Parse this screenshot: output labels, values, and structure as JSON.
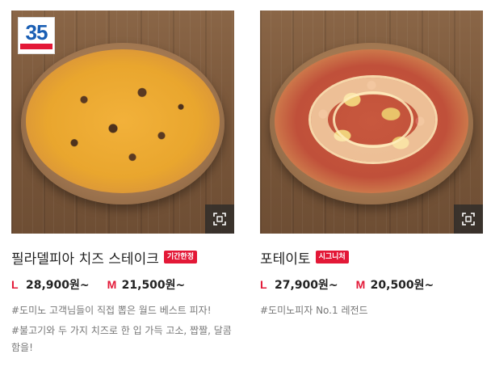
{
  "products": [
    {
      "name": "필라델피아 치즈 스테이크",
      "tag": "기간한정",
      "anniversary_badge": "35",
      "sizes": [
        {
          "size": "L",
          "price": "28,900원~"
        },
        {
          "size": "M",
          "price": "21,500원~"
        }
      ],
      "descriptions": [
        "#도미노 고객님들이 직접 뽑은 월드 베스트 피자!",
        "#불고기와 두 가지 치즈로 한 입 가득 고소, 짭짤, 달콤함을!"
      ],
      "zoom_icon": "expand-icon"
    },
    {
      "name": "포테이토",
      "tag": "시그니처",
      "sizes": [
        {
          "size": "L",
          "price": "27,900원~"
        },
        {
          "size": "M",
          "price": "20,500원~"
        }
      ],
      "descriptions": [
        "#도미노피자 No.1 레전드"
      ],
      "zoom_icon": "expand-icon"
    }
  ],
  "colors": {
    "accent": "#e31837",
    "text": "#222222",
    "muted": "#777777"
  }
}
